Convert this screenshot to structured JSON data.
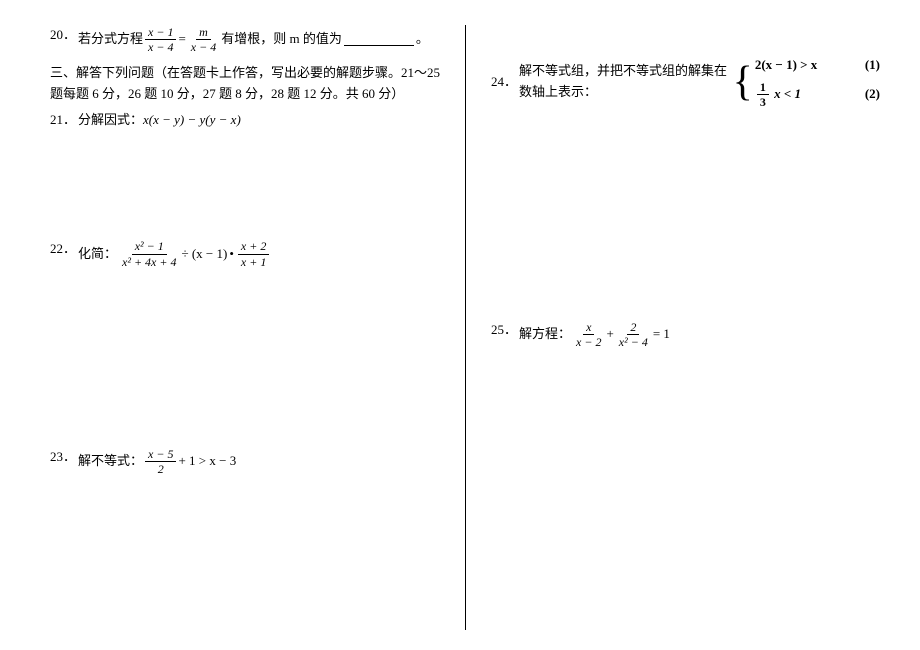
{
  "left": {
    "q20": {
      "num": "20．",
      "pre": "若分式方程",
      "eqL_num": "x − 1",
      "eqL_den": "x − 4",
      "eqMid": "=",
      "eqR_num": "m",
      "eqR_den": "x − 4",
      "post1": "有增根，则 m 的值为",
      "post2": "。"
    },
    "section": "三、解答下列问题（在答题卡上作答，写出必要的解题步骤。21～25 题每题 6 分，26 题 10 分，27 题 8 分，28 题 12 分。共 60 分）",
    "q21": {
      "num": "21．",
      "label": "分解因式：",
      "expr": "x(x − y) − y(y − x)"
    },
    "q22": {
      "num": "22．",
      "label": "化简：",
      "f1_num": "x² − 1",
      "f1_den": "x² + 4x + 4",
      "op1": "÷ (x − 1)",
      "dot": "•",
      "f2_num": "x + 2",
      "f2_den": "x + 1"
    },
    "q23": {
      "num": "23．",
      "label": "解不等式：",
      "f_num": "x − 5",
      "f_den": "2",
      "rest": "+ 1 > x − 3"
    }
  },
  "right": {
    "q24": {
      "num": "24．",
      "label": "解不等式组，并把不等式组的解集在数轴上表示：",
      "line1": "2(x − 1) > x",
      "tag1": "(1)",
      "line2_num": "1",
      "line2_den": "3",
      "line2_rest": "x < 1",
      "tag2": "(2)"
    },
    "q25": {
      "num": "25．",
      "label": "解方程：",
      "f1_num": "x",
      "f1_den": "x − 2",
      "plus": "+",
      "f2_num": "2",
      "f2_den": "x² − 4",
      "eq": "= 1"
    }
  }
}
